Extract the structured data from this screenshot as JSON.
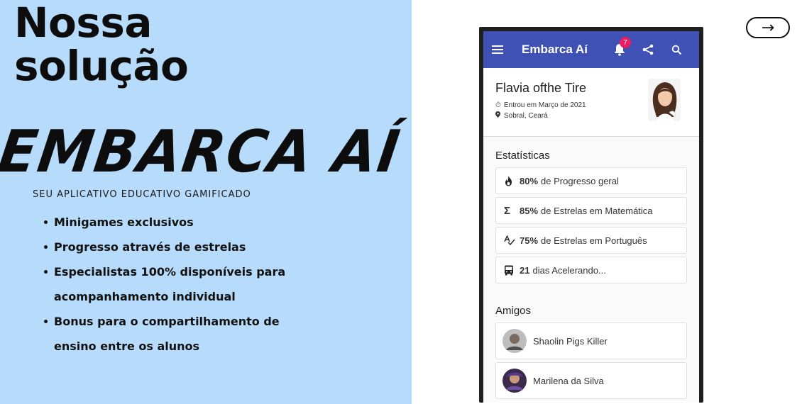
{
  "promo": {
    "headline_line1": "Nossa",
    "headline_line2": "solução",
    "brand": "EMBARCA AÍ",
    "tagline": "SEU APLICATIVO EDUCATIVO GAMIFICADO",
    "features": [
      {
        "line1": "Minigames exclusivos",
        "line2": ""
      },
      {
        "line1": "Progresso através de estrelas",
        "line2": ""
      },
      {
        "line1": "Especialistas 100% disponíveis para",
        "line2": "acompanhamento individual"
      },
      {
        "line1": "Bonus para o compartilhamento de",
        "line2": "ensino entre os alunos"
      }
    ],
    "next_arrow": "→"
  },
  "app": {
    "title": "Embarca Aí",
    "notification_count": "7",
    "icons": [
      "menu-icon",
      "bell-icon",
      "share-icon",
      "search-icon"
    ],
    "accent_color": "#3f51b5",
    "badge_color": "#e91e63",
    "profile": {
      "name": "Flavia ofthe Tire",
      "joined": "Entrou em Março de 2021",
      "location": "Sobral, Ceará"
    },
    "stats_title": "Estatísticas",
    "stats": [
      {
        "icon": "fire-icon",
        "value": "80%",
        "label": "de Progresso geral"
      },
      {
        "icon": "sigma-icon",
        "value": "85%",
        "label": "de Estrelas em Matemática"
      },
      {
        "icon": "spellcheck-icon",
        "value": "75%",
        "label": "de Estrelas em Português"
      },
      {
        "icon": "bus-icon",
        "value": "21",
        "label": "dias Acelerando..."
      }
    ],
    "friends_title": "Amigos",
    "friends": [
      {
        "name": "Shaolin Pigs Killer"
      },
      {
        "name": "Marilena da Silva"
      }
    ]
  }
}
